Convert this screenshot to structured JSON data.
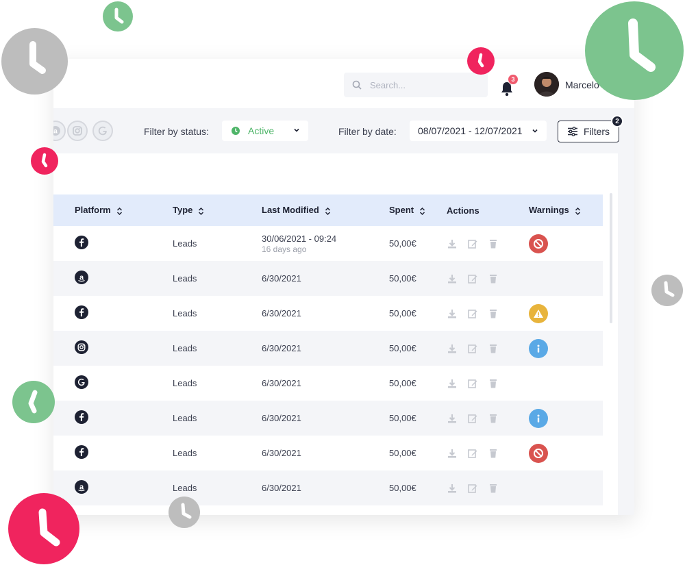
{
  "header": {
    "search_placeholder": "Search...",
    "notification_count": "3",
    "username": "Marcelo"
  },
  "filters": {
    "status_label": "Filter by status:",
    "status_value": "Active",
    "date_label": "Filter by date:",
    "date_value": "08/07/2021 - 12/07/2021",
    "filters_button": "Filters",
    "filters_count": "2",
    "platform_chips": [
      "amazon-icon",
      "instagram-icon",
      "google-icon"
    ]
  },
  "table": {
    "columns": [
      "Platform",
      "Type",
      "Last Modified",
      "Spent",
      "Actions",
      "Warnings"
    ],
    "rows": [
      {
        "platform": "facebook",
        "type": "Leads",
        "modified": "30/06/2021 - 09:24",
        "modified_sub": "16 days ago",
        "spent": "50,00€",
        "warning": "blocked"
      },
      {
        "platform": "amazon",
        "type": "Leads",
        "modified": "6/30/2021",
        "modified_sub": "",
        "spent": "50,00€",
        "warning": ""
      },
      {
        "platform": "facebook",
        "type": "Leads",
        "modified": "6/30/2021",
        "modified_sub": "",
        "spent": "50,00€",
        "warning": "alert"
      },
      {
        "platform": "instagram",
        "type": "Leads",
        "modified": "6/30/2021",
        "modified_sub": "",
        "spent": "50,00€",
        "warning": "info"
      },
      {
        "platform": "google",
        "type": "Leads",
        "modified": "6/30/2021",
        "modified_sub": "",
        "spent": "50,00€",
        "warning": ""
      },
      {
        "platform": "facebook",
        "type": "Leads",
        "modified": "6/30/2021",
        "modified_sub": "",
        "spent": "50,00€",
        "warning": "info"
      },
      {
        "platform": "facebook",
        "type": "Leads",
        "modified": "6/30/2021",
        "modified_sub": "",
        "spent": "50,00€",
        "warning": "blocked"
      },
      {
        "platform": "amazon",
        "type": "Leads",
        "modified": "6/30/2021",
        "modified_sub": "",
        "spent": "50,00€",
        "warning": ""
      }
    ]
  },
  "colors": {
    "accent_green": "#4fb569",
    "header_row": "#e2ebfb",
    "warning_red": "#d9534f",
    "warning_yellow": "#e8b43c",
    "info_blue": "#5aa9e6",
    "deco_green": "#7cc48e",
    "deco_pink": "#f0245e",
    "deco_gray": "#bdbdbd"
  }
}
